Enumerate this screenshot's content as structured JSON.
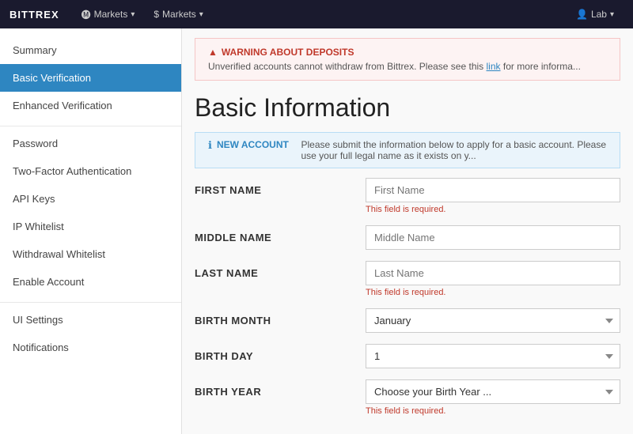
{
  "header": {
    "logo": "BITTREX",
    "nav_items": [
      {
        "label": "Markets",
        "icon": "▾"
      },
      {
        "label": "Markets",
        "icon": "▾"
      }
    ],
    "lab_label": "Lab",
    "lab_icon": "▾",
    "user_icon": "👤"
  },
  "sidebar": {
    "items": [
      {
        "id": "summary",
        "label": "Summary",
        "active": false,
        "group": 0
      },
      {
        "id": "basic-verification",
        "label": "Basic Verification",
        "active": true,
        "group": 0
      },
      {
        "id": "enhanced-verification",
        "label": "Enhanced Verification",
        "active": false,
        "group": 0
      },
      {
        "id": "password",
        "label": "Password",
        "active": false,
        "group": 1
      },
      {
        "id": "two-factor",
        "label": "Two-Factor Authentication",
        "active": false,
        "group": 1
      },
      {
        "id": "api-keys",
        "label": "API Keys",
        "active": false,
        "group": 1
      },
      {
        "id": "ip-whitelist",
        "label": "IP Whitelist",
        "active": false,
        "group": 1
      },
      {
        "id": "withdrawal-whitelist",
        "label": "Withdrawal Whitelist",
        "active": false,
        "group": 1
      },
      {
        "id": "enable-account",
        "label": "Enable Account",
        "active": false,
        "group": 1
      },
      {
        "id": "ui-settings",
        "label": "UI Settings",
        "active": false,
        "group": 2
      },
      {
        "id": "notifications",
        "label": "Notifications",
        "active": false,
        "group": 2
      }
    ]
  },
  "main": {
    "warning": {
      "title": "WARNING ABOUT DEPOSITS",
      "text": "Unverified accounts cannot withdraw from Bittrex. Please see this",
      "link_text": "link",
      "text_after": "for more informa..."
    },
    "page_title": "Basic Information",
    "info_banner": {
      "title": "NEW ACCOUNT",
      "text": "Please submit the information below to apply for a basic account. Please use your full legal name as it exists on y..."
    },
    "form": {
      "fields": [
        {
          "id": "first-name",
          "label": "FIRST NAME",
          "type": "text",
          "placeholder": "First Name",
          "value": "",
          "error": "This field is required."
        },
        {
          "id": "middle-name",
          "label": "MIDDLE NAME",
          "type": "text",
          "placeholder": "Middle Name",
          "value": "",
          "error": ""
        },
        {
          "id": "last-name",
          "label": "LAST NAME",
          "type": "text",
          "placeholder": "Last Name",
          "value": "",
          "error": "This field is required."
        },
        {
          "id": "birth-month",
          "label": "BIRTH MONTH",
          "type": "select",
          "placeholder": "January",
          "value": "January",
          "error": ""
        },
        {
          "id": "birth-day",
          "label": "BIRTH DAY",
          "type": "select",
          "placeholder": "1",
          "value": "1",
          "error": ""
        },
        {
          "id": "birth-year",
          "label": "BIRTH YEAR",
          "type": "select",
          "placeholder": "Choose your Birth Year ...",
          "value": "",
          "error": "This field is required."
        }
      ]
    }
  }
}
